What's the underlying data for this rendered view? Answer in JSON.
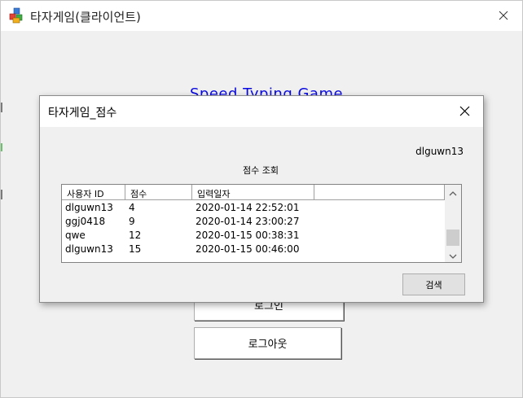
{
  "main_window": {
    "title": "타자게임(클라이언트)",
    "body_title": "Speed Typing Game",
    "login_button_label": "로그인",
    "logout_button_label": "로그아웃"
  },
  "dialog": {
    "title": "타자게임_점수",
    "username": "dlguwn13",
    "section_label": "점수 조회",
    "columns": [
      "사용자 ID",
      "점수",
      "입력일자",
      ""
    ],
    "rows": [
      [
        "dlguwn13",
        "4",
        "2020-01-14 22:52:01"
      ],
      [
        "ggj0418",
        "9",
        "2020-01-14 23:00:27"
      ],
      [
        "qwe",
        "12",
        "2020-01-15 00:38:31"
      ],
      [
        "dlguwn13",
        "15",
        "2020-01-15 00:46:00"
      ]
    ],
    "search_button_label": "검색"
  },
  "icons": {
    "app": "colored-blocks-icon",
    "close": "close-icon",
    "scroll_up": "chevron-up-icon",
    "scroll_down": "chevron-down-icon"
  },
  "colors": {
    "title_accent": "#0a0ae0"
  }
}
